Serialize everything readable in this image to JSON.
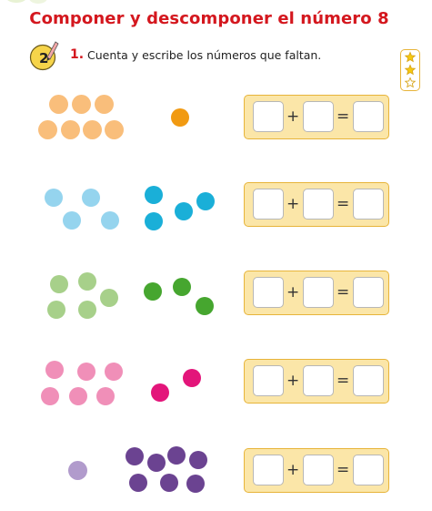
{
  "header": {
    "title": "Componer y descomponer el número 8"
  },
  "exercise": {
    "badge_number": "2",
    "number": "1.",
    "instruction": "Cuenta y escribe los números que faltan."
  },
  "difficulty": {
    "icon": "star-icon",
    "filled": 2,
    "total": 3
  },
  "equation_symbols": {
    "plus": "+",
    "equals": "="
  },
  "rows": [
    {
      "color": "#f9be7b",
      "accent": "#f19a12",
      "left_count": 7,
      "right_count": 1
    },
    {
      "color": "#95d4ee",
      "accent": "#1aafd8",
      "left_count": 4,
      "right_count": 4
    },
    {
      "color": "#a7d08a",
      "accent": "#46a62f",
      "left_count": 5,
      "right_count": 3
    },
    {
      "color": "#f08fb8",
      "accent": "#e3157a",
      "left_count": 6,
      "right_count": 2
    },
    {
      "color": "#b19bcc",
      "accent": "#6b4391",
      "left_count": 1,
      "right_count": 7
    }
  ],
  "colors": {
    "title_red": "#d4171e",
    "box_fill": "#fbe6a8",
    "box_border": "#e7b43a"
  }
}
